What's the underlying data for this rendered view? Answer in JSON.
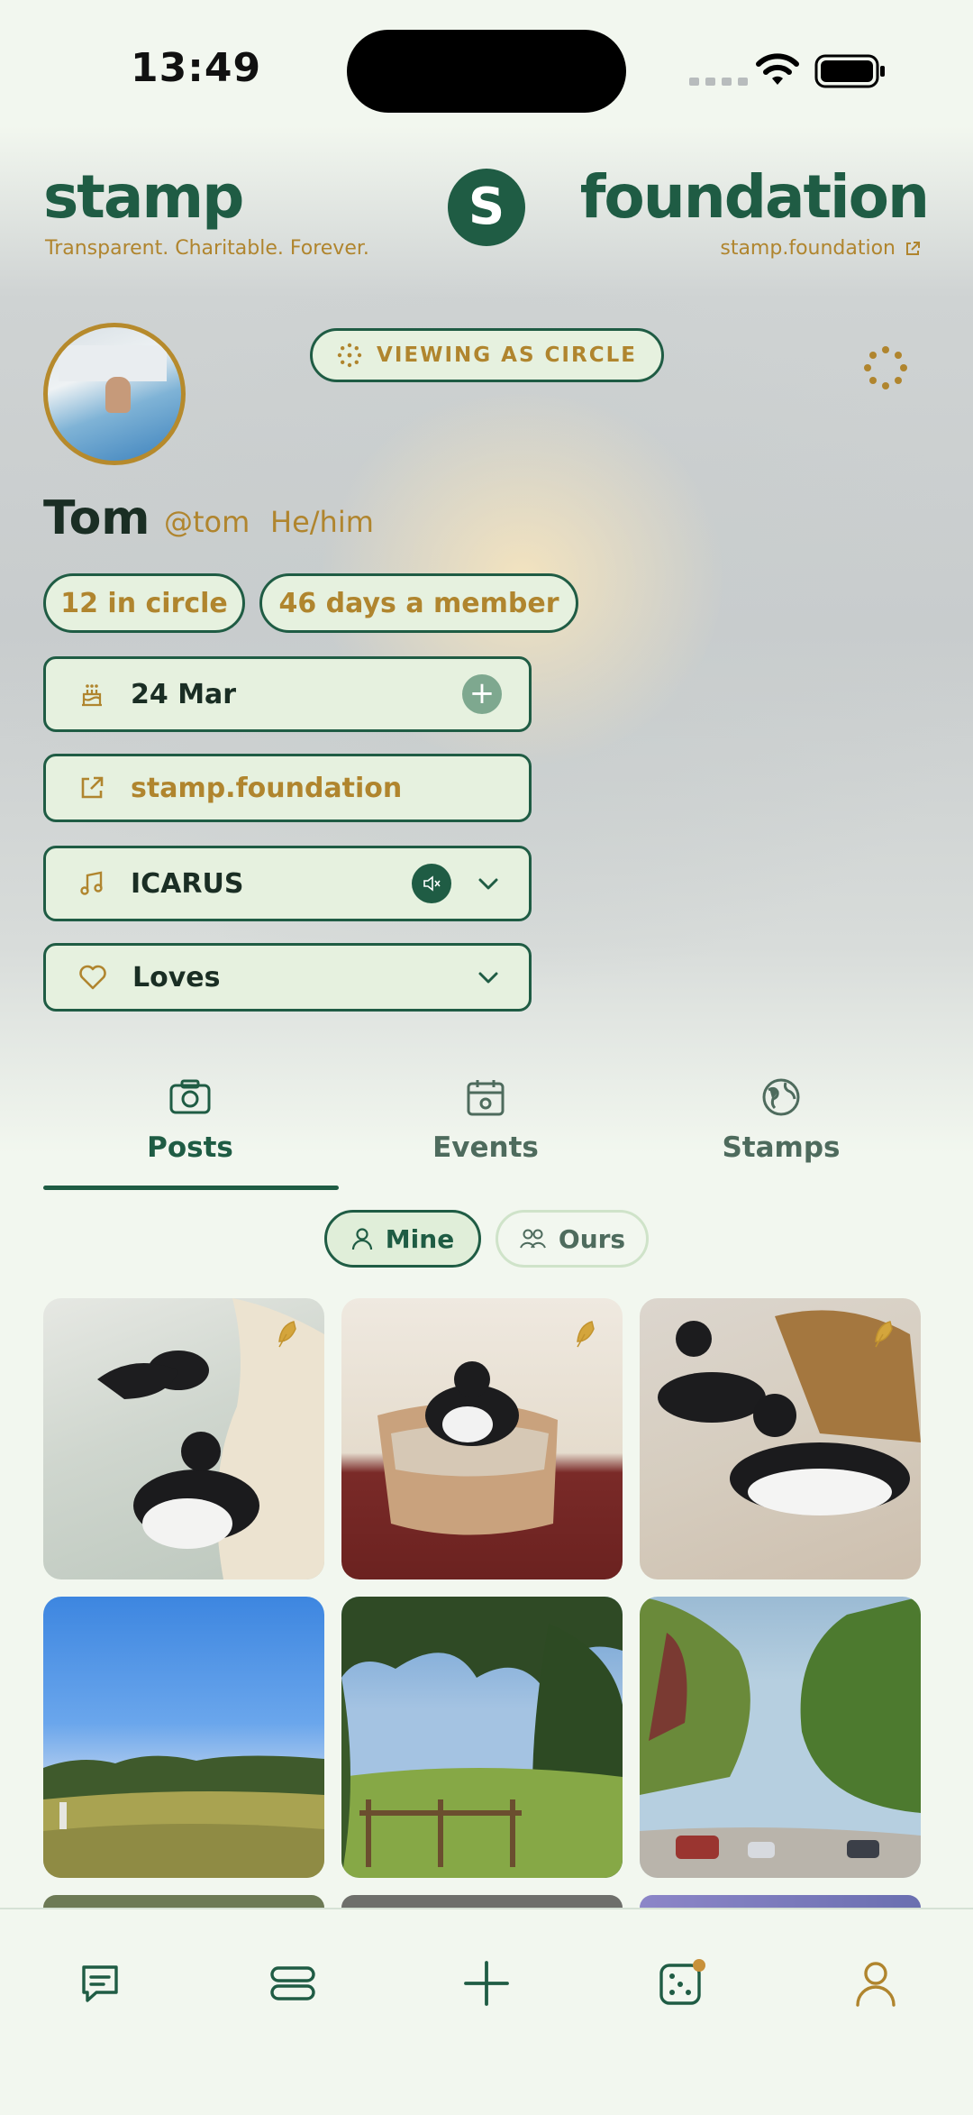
{
  "status": {
    "time": "13:49"
  },
  "header": {
    "brand_left": "stamp",
    "tagline": "Transparent. Charitable. Forever.",
    "logo_letter": "S",
    "brand_right": "foundation",
    "site_link": "stamp.foundation"
  },
  "profile": {
    "viewing_badge": "VIEWING AS CIRCLE",
    "name": "Tom",
    "handle": "@tom",
    "pronouns": "He/him",
    "circle_count": "12 in circle",
    "member_days": "46 days a member",
    "birthday": "24 Mar",
    "website": "stamp.foundation",
    "song": "ICARUS",
    "loves_label": "Loves"
  },
  "tabs": [
    {
      "label": "Posts",
      "icon": "camera-icon",
      "active": true
    },
    {
      "label": "Events",
      "icon": "calendar-icon",
      "active": false
    },
    {
      "label": "Stamps",
      "icon": "globe-icon",
      "active": false
    }
  ],
  "filters": [
    {
      "label": "Mine",
      "icon": "person-icon",
      "active": true
    },
    {
      "label": "Ours",
      "icon": "people-icon",
      "active": false
    }
  ],
  "posts": [
    {
      "subject": "two cats by sofa",
      "has_leaf": true
    },
    {
      "subject": "cats on wicker bed",
      "has_leaf": true
    },
    {
      "subject": "two cats on rug",
      "has_leaf": true
    },
    {
      "subject": "golf course field",
      "has_leaf": false
    },
    {
      "subject": "meadow with fence",
      "has_leaf": false
    },
    {
      "subject": "tree lined street",
      "has_leaf": false
    }
  ],
  "bottom_nav": [
    "chat-icon",
    "feed-icon",
    "add-icon",
    "dice-icon",
    "profile-icon"
  ],
  "colors": {
    "primary": "#1f5c44",
    "accent": "#b0852e",
    "chip_bg": "#e6f1df",
    "page_bg": "#f2f7ef"
  }
}
